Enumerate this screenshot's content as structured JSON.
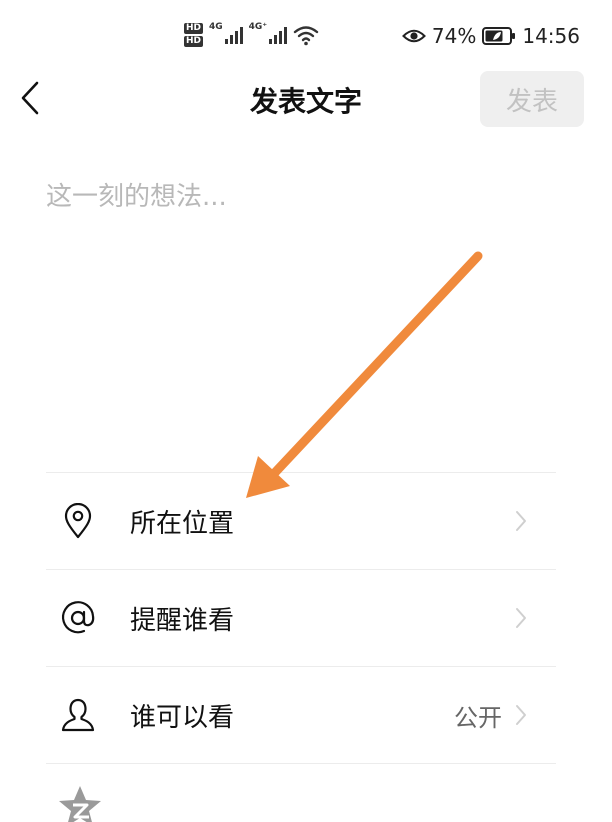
{
  "status_bar": {
    "hd_1": "HD",
    "hd_2": "HD",
    "net_1": "4G",
    "net_2": "4G⁺",
    "battery_percent": "74%",
    "time": "14:56",
    "battery_level": 0.74
  },
  "header": {
    "title": "发表文字",
    "publish_label": "发表",
    "back_icon": "chevron-left-icon"
  },
  "post": {
    "placeholder": "这一刻的想法..."
  },
  "options": {
    "location": {
      "label": "所在位置",
      "icon": "location-pin-icon"
    },
    "mention": {
      "label": "提醒谁看",
      "icon": "at-sign-icon"
    },
    "visibility": {
      "label": "谁可以看",
      "value": "公开",
      "icon": "person-icon"
    }
  },
  "colors": {
    "annotation_arrow": "#f08a3c",
    "publish_disabled_bg": "#efefef",
    "publish_disabled_text": "#c2c2c2",
    "placeholder": "#b8b8b8",
    "divider": "#ececec"
  }
}
